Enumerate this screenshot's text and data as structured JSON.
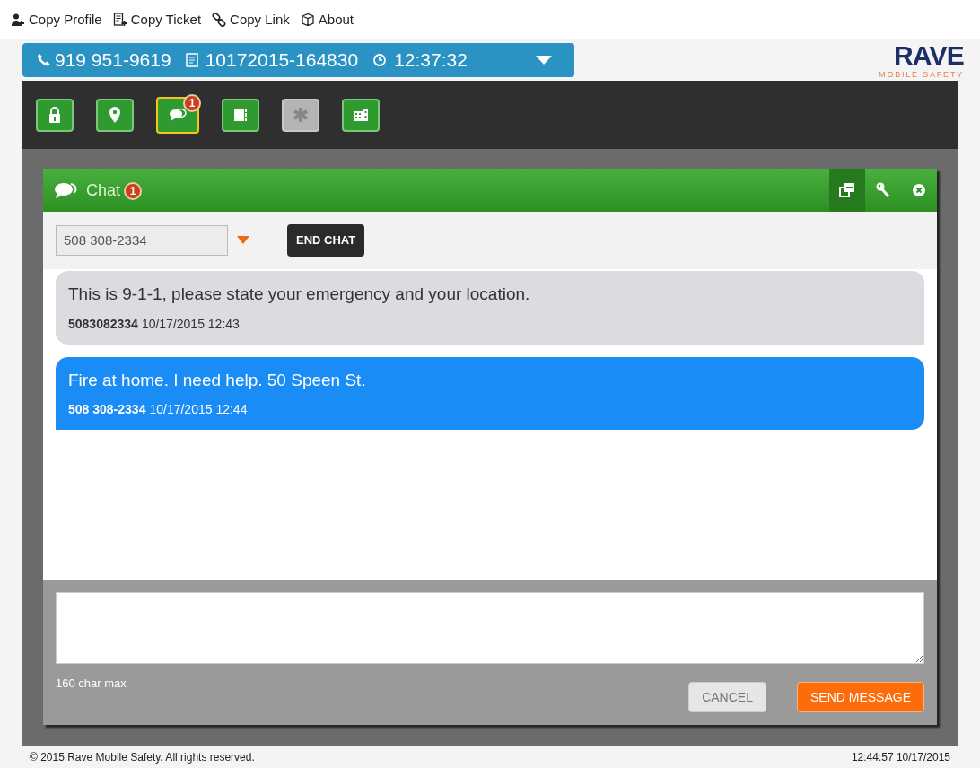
{
  "menu": [
    {
      "kind": "profile",
      "label": "Copy Profile"
    },
    {
      "kind": "ticket",
      "label": "Copy Ticket"
    },
    {
      "kind": "link",
      "label": "Copy Link"
    },
    {
      "kind": "about",
      "label": "About"
    }
  ],
  "call_bar": {
    "phone": "919 951-9619",
    "ticket": "10172015-164830",
    "time": "12:37:32"
  },
  "logo": {
    "name": "RAVE",
    "tagline": "MOBILE SAFETY"
  },
  "tools": [
    {
      "kind": "info",
      "selected": false,
      "disabled": false
    },
    {
      "kind": "pin",
      "selected": false,
      "disabled": false
    },
    {
      "kind": "chat",
      "selected": true,
      "disabled": false,
      "badge": "1"
    },
    {
      "kind": "book",
      "selected": false,
      "disabled": false
    },
    {
      "kind": "medical",
      "selected": false,
      "disabled": true
    },
    {
      "kind": "building",
      "selected": false,
      "disabled": false
    }
  ],
  "chat": {
    "title": "Chat",
    "badge": "1",
    "contact": "508 308-2334",
    "end_button": "END CHAT",
    "messages": [
      {
        "kind": "incoming",
        "text": "This is 9-1-1, please state your emergency and your location.",
        "sender": "5083082334",
        "time": "10/17/2015 12:43"
      },
      {
        "kind": "outgoing",
        "text": "Fire at home. I need help. 50 Speen St.",
        "sender": "508 308-2334",
        "time": "10/17/2015 12:44"
      }
    ],
    "limit": "160 char max",
    "cancel": "CANCEL",
    "send": "SEND MESSAGE"
  },
  "footer": {
    "copyright": "© 2015 Rave Mobile Safety. All rights reserved.",
    "timestamp": "12:44:57 10/17/2015"
  }
}
